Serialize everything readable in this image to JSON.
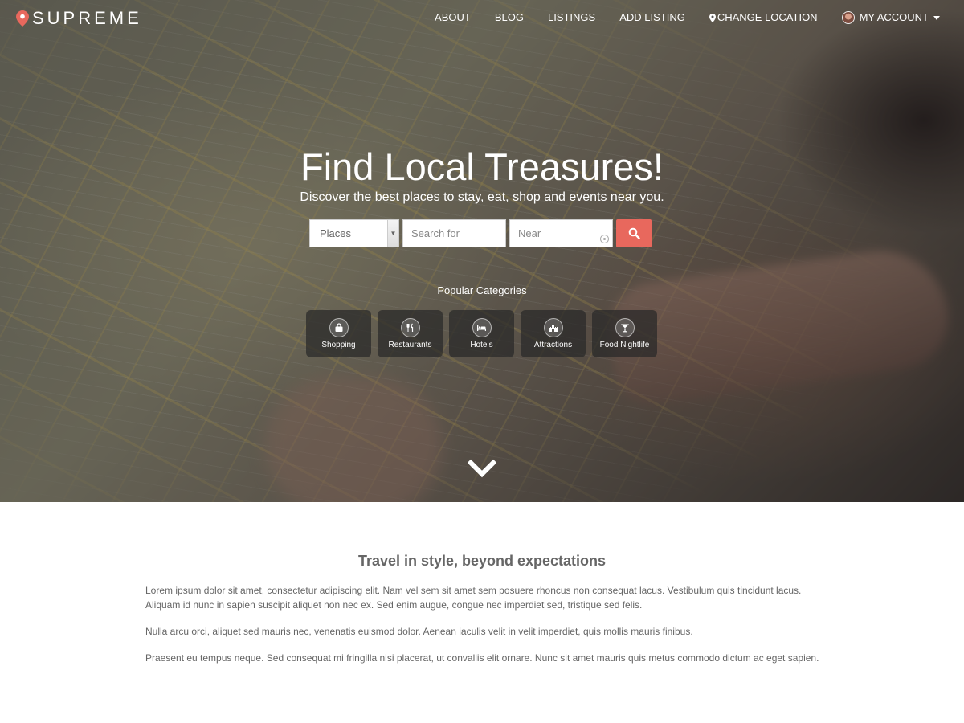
{
  "brand": {
    "name": "SUPREME",
    "pin_color": "#e8685d"
  },
  "nav": {
    "items": [
      {
        "label": "ABOUT"
      },
      {
        "label": "BLOG"
      },
      {
        "label": "LISTINGS"
      },
      {
        "label": "ADD LISTING"
      },
      {
        "label": "CHANGE LOCATION",
        "icon": "map-marker-icon"
      },
      {
        "label": "MY ACCOUNT",
        "icon": "avatar"
      }
    ]
  },
  "hero": {
    "title": "Find Local Treasures!",
    "subtitle": "Discover the best places to stay, eat, shop and events near you.",
    "search": {
      "type_selected": "Places",
      "search_placeholder": "Search for",
      "near_placeholder": "Near",
      "button_icon": "search-icon",
      "button_color": "#e8685d"
    },
    "popular_title": "Popular Categories",
    "categories": [
      {
        "label": "Shopping",
        "icon": "shopping-bag-icon"
      },
      {
        "label": "Restaurants",
        "icon": "cutlery-icon"
      },
      {
        "label": "Hotels",
        "icon": "bed-icon"
      },
      {
        "label": "Attractions",
        "icon": "castle-icon"
      },
      {
        "label": "Food Nightlife",
        "icon": "cocktail-icon"
      }
    ],
    "scroll_icon": "chevron-down-icon"
  },
  "content": {
    "title": "Travel in style, beyond expectations",
    "paragraphs": [
      "Lorem ipsum dolor sit amet, consectetur adipiscing elit. Nam vel sem sit amet sem posuere rhoncus non consequat lacus. Vestibulum quis tincidunt lacus. Aliquam id nunc in sapien suscipit aliquet non nec ex. Sed enim augue, congue nec imperdiet sed, tristique sed felis.",
      "Nulla arcu orci, aliquet sed mauris nec, venenatis euismod dolor. Aenean iaculis velit in velit imperdiet, quis mollis mauris finibus.",
      "Praesent eu tempus neque. Sed consequat mi fringilla nisi placerat, ut convallis elit ornare. Nunc sit amet mauris quis metus commodo dictum ac eget sapien."
    ]
  }
}
